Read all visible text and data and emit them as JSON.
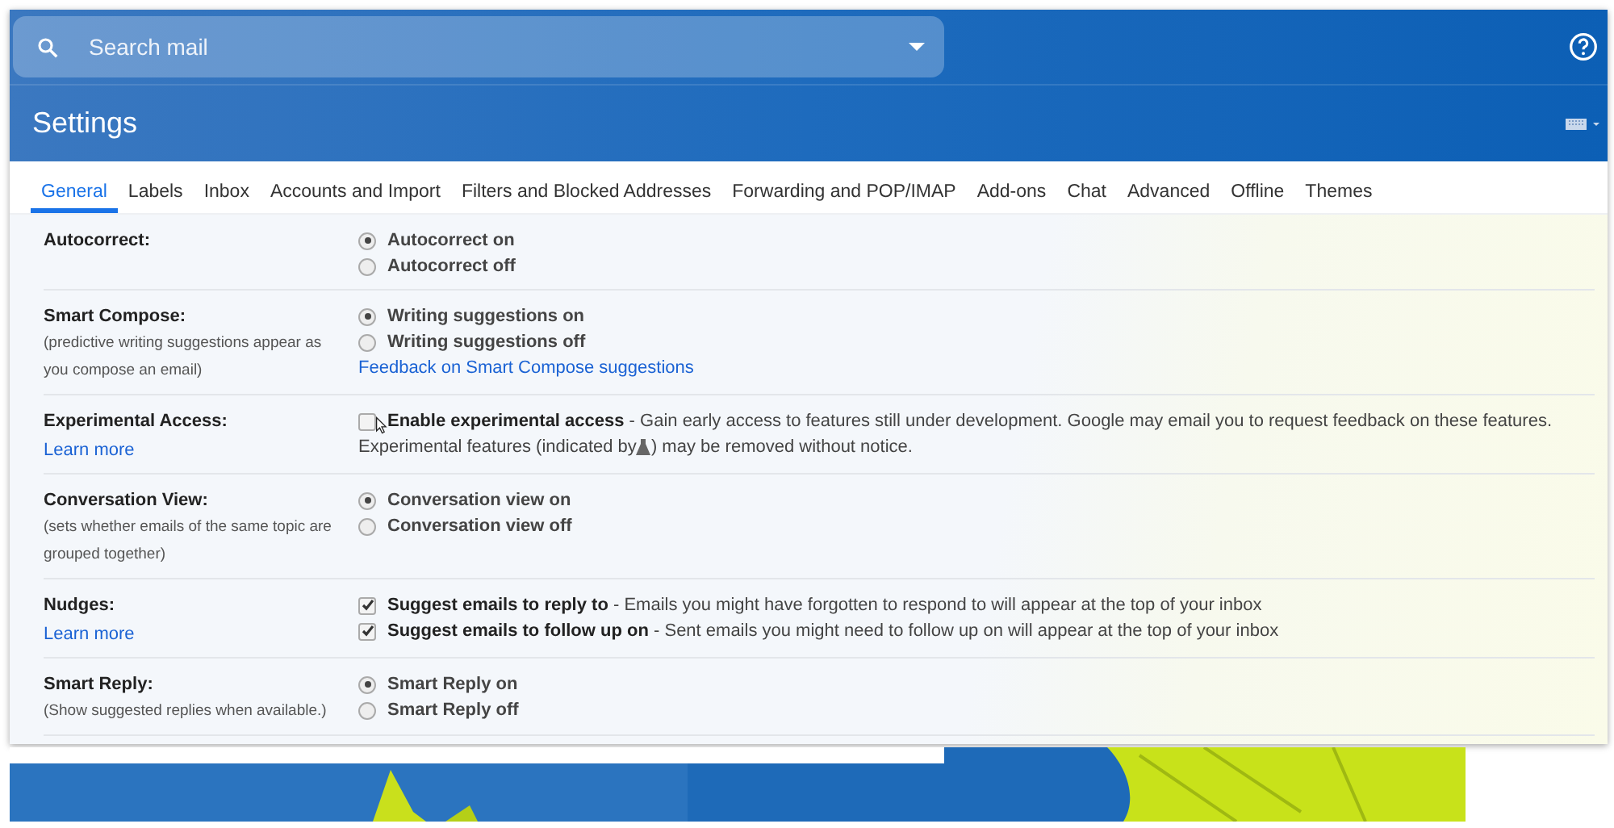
{
  "search": {
    "placeholder": "Search mail"
  },
  "page_title": "Settings",
  "tabs": [
    {
      "label": "General",
      "selected": true
    },
    {
      "label": "Labels",
      "selected": false
    },
    {
      "label": "Inbox",
      "selected": false
    },
    {
      "label": "Accounts and Import",
      "selected": false
    },
    {
      "label": "Filters and Blocked Addresses",
      "selected": false
    },
    {
      "label": "Forwarding and POP/IMAP",
      "selected": false
    },
    {
      "label": "Add-ons",
      "selected": false
    },
    {
      "label": "Chat",
      "selected": false
    },
    {
      "label": "Advanced",
      "selected": false
    },
    {
      "label": "Offline",
      "selected": false
    },
    {
      "label": "Themes",
      "selected": false
    }
  ],
  "settings": [
    {
      "label": "Autocorrect:",
      "options": [
        {
          "kind": "radio",
          "text": "Autocorrect on",
          "selected": true
        },
        {
          "kind": "radio",
          "text": "Autocorrect off",
          "selected": false
        }
      ]
    },
    {
      "label": "Smart Compose:",
      "description": "(predictive writing suggestions appear as you compose an email)",
      "options": [
        {
          "kind": "radio",
          "text": "Writing suggestions on",
          "selected": true
        },
        {
          "kind": "radio",
          "text": "Writing suggestions off",
          "selected": false
        }
      ],
      "option_link": "Feedback on Smart Compose suggestions"
    },
    {
      "label": "Experimental Access:",
      "link": "Learn more",
      "options": [
        {
          "kind": "checkbox",
          "text": "**Enable experimental access** - Gain early access to features still under development. Google may email you to request feedback on these features.",
          "checked": false
        }
      ],
      "note_parts": [
        "Experimental features (indicated by",
        ") may be removed without notice."
      ]
    },
    {
      "label": "Conversation View:",
      "description": "(sets whether emails of the same topic are grouped together)",
      "options": [
        {
          "kind": "radio",
          "text": "Conversation view on",
          "selected": true
        },
        {
          "kind": "radio",
          "text": "Conversation view off",
          "selected": false
        }
      ]
    },
    {
      "label": "Nudges:",
      "link": "Learn more",
      "options": [
        {
          "kind": "checkbox",
          "text": "**Suggest emails to reply to** - Emails you might have forgotten to respond to will appear at the top of your inbox",
          "checked": true
        },
        {
          "kind": "checkbox",
          "text": "**Suggest emails to follow up on** - Sent emails you might need to follow up on will appear at the top of your inbox",
          "checked": true
        }
      ]
    },
    {
      "label": "Smart Reply:",
      "description": "(Show suggested replies when available.)",
      "options": [
        {
          "kind": "radio",
          "text": "Smart Reply on",
          "selected": true
        },
        {
          "kind": "radio",
          "text": "Smart Reply off",
          "selected": false
        }
      ]
    }
  ]
}
